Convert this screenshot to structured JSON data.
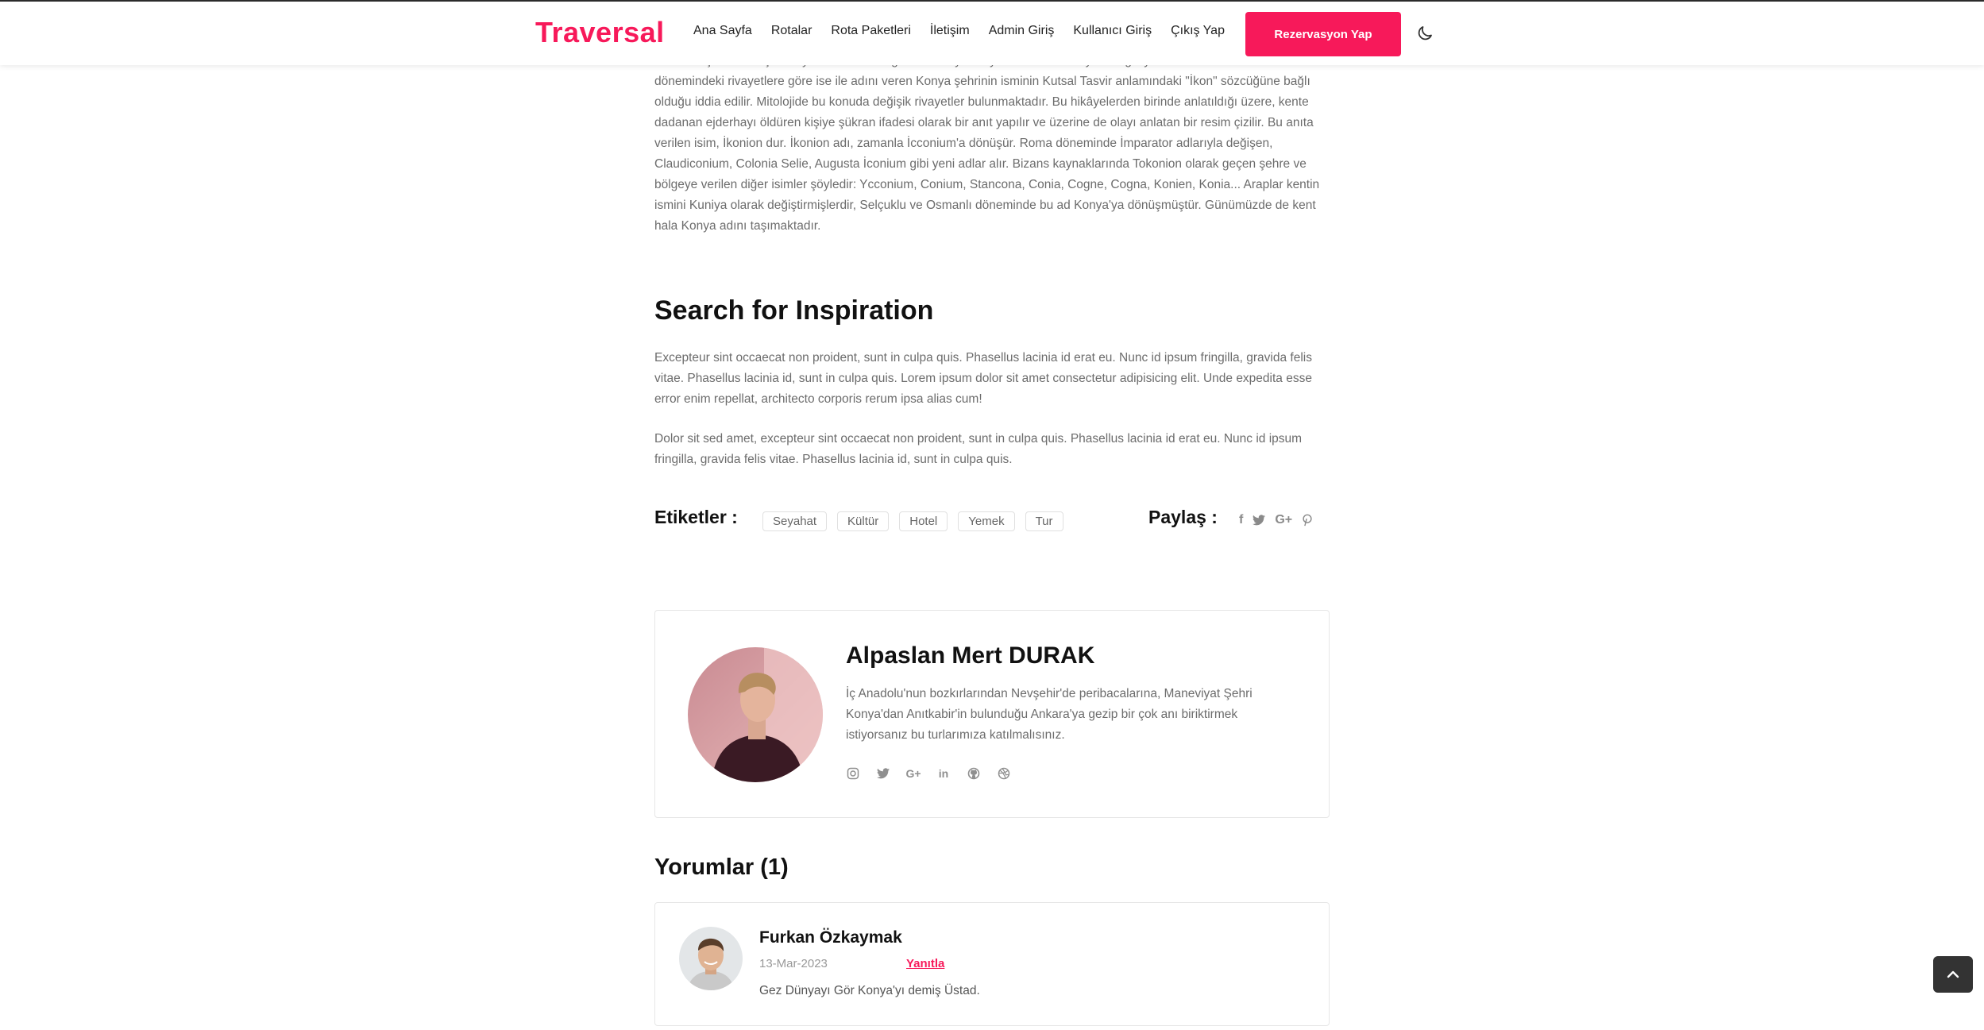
{
  "brand": "Traversal",
  "nav": [
    "Ana Sayfa",
    "Rotalar",
    "Rota Paketleri",
    "İletişim",
    "Admin Giriş",
    "Kullanıcı Giriş",
    "Çıkış Yap"
  ],
  "cta_label": "Rezervasyon Yap",
  "theme_toggle_icon": "moon-icon",
  "intro_text": "adlarının şehrin Hititçe ismiyle olan benzerliğinden dolayı Konya adının İkuwaniya'dan geliyor olması olasıdır. Bizans dönemindeki rivayetlere göre ise ile adını veren Konya şehrinin isminin Kutsal Tasvir anlamındaki \"İkon\" sözcüğüne bağlı olduğu iddia edilir. Mitolojide bu konuda değişik rivayetler bulunmaktadır. Bu hikâyelerden birinde anlatıldığı üzere, kente dadanan ejderhayı öldüren kişiye şükran ifadesi olarak bir anıt yapılır ve üzerine de olayı anlatan bir resim çizilir. Bu anıta verilen isim, İkonion dur. İkonion adı, zamanla İcconium'a dönüşür. Roma döneminde İmparator adlarıyla değişen, Claudiconium, Colonia Selie, Augusta İconium gibi yeni adlar alır. Bizans kaynaklarında Tokonion olarak geçen şehre ve bölgeye verilen diğer isimler şöyledir: Ycconium, Conium, Stancona, Conia, Cogne, Cogna, Konien, Konia... Araplar kentin ismini Kuniya olarak değiştirmişlerdir, Selçuklu ve Osmanlı döneminde bu ad Konya'ya dönüşmüştür. Günümüzde de kent hala Konya adını taşımaktadır.",
  "section_title": "Search for Inspiration",
  "paragraph_1": "Excepteur sint occaecat non proident, sunt in culpa quis. Phasellus lacinia id erat eu. Nunc id ipsum fringilla, gravida felis vitae. Phasellus lacinia id, sunt in culpa quis. Lorem ipsum dolor sit amet consectetur adipisicing elit. Unde expedita esse error enim repellat, architecto corporis rerum ipsa alias cum!",
  "paragraph_2": "Dolor sit sed amet, excepteur sint occaecat non proident, sunt in culpa quis. Phasellus lacinia id erat eu. Nunc id ipsum fringilla, gravida felis vitae. Phasellus lacinia id, sunt in culpa quis.",
  "tags_label": "Etiketler :",
  "tags": [
    "Seyahat",
    "Kültür",
    "Hotel",
    "Yemek",
    "Tur"
  ],
  "share_label": "Paylaş :",
  "share_icons": [
    "facebook-icon",
    "twitter-icon",
    "google-plus-icon",
    "pinterest-icon"
  ],
  "author": {
    "name": "Alpaslan Mert DURAK",
    "bio": "İç Anadolu'nun bozkırlarından Nevşehir'de peribacalarına, Maneviyat Şehri Konya'dan Anıtkabir'in bulunduğu Ankara'ya gezip bir çok anı biriktirmek istiyorsanız bu turlarımıza katılmalısınız.",
    "social_icons": [
      "instagram-icon",
      "twitter-icon",
      "google-plus-icon",
      "linkedin-icon",
      "github-icon",
      "dribbble-icon"
    ]
  },
  "comments_title": "Yorumlar (1)",
  "comment": {
    "name": "Furkan Özkaymak",
    "date": "13-Mar-2023",
    "reply_label": "Yanıtla",
    "text": "Gez Dünyayı Gör Konya'yı demiş Üstad."
  },
  "colors": {
    "accent": "#f7195a",
    "text": "#111111",
    "muted": "#6c6c6c"
  }
}
